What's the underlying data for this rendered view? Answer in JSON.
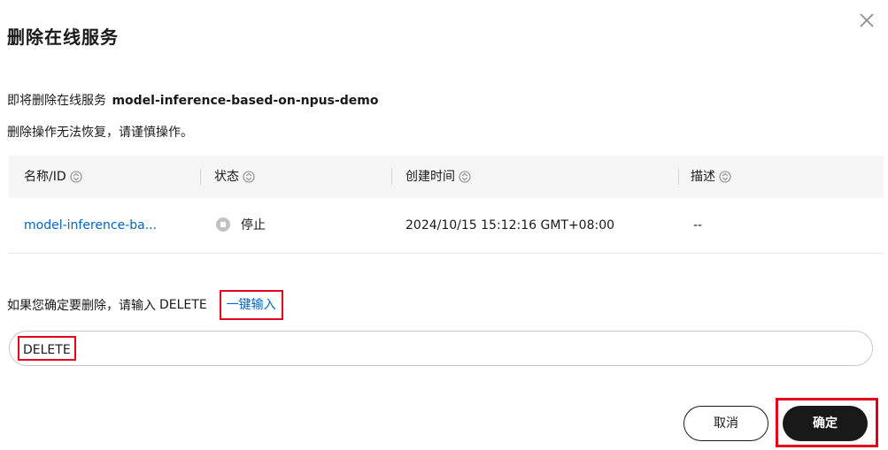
{
  "dialog": {
    "title": "删除在线服务",
    "close_icon": "close-icon",
    "message_prefix": "即将删除在线服务",
    "service_name": "model-inference-based-on-npus-demo",
    "warning": "删除操作无法恢复，请谨慎操作。"
  },
  "table": {
    "columns": [
      {
        "label": "名称/ID",
        "icon": "sort-icon"
      },
      {
        "label": "状态",
        "icon": "sort-icon"
      },
      {
        "label": "创建时间",
        "icon": "sort-icon"
      },
      {
        "label": "描述",
        "icon": "sort-icon"
      }
    ],
    "rows": [
      {
        "name": "model-inference-ba...",
        "status": "停止",
        "status_icon": "stopped-status-icon",
        "created": "2024/10/15 15:12:16 GMT+08:00",
        "description": "--"
      }
    ]
  },
  "confirm": {
    "prompt": "如果您确定要删除，请输入",
    "keyword": "DELETE",
    "quick_fill": "一键输入",
    "input_value": "DELETE"
  },
  "buttons": {
    "cancel": "取消",
    "ok": "确定"
  },
  "colors": {
    "link": "#0064c8",
    "highlight": "#e6001a",
    "primary_button": "#191919",
    "header_bg": "#f5f5f5"
  }
}
